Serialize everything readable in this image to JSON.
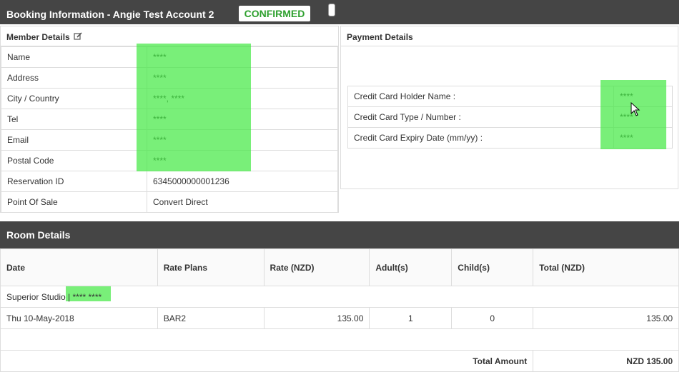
{
  "header": {
    "title": "Booking Information - Angie Test Account 2",
    "status": "CONFIRMED"
  },
  "member": {
    "heading": "Member Details",
    "rows": [
      {
        "label": "Name",
        "value": "****"
      },
      {
        "label": "Address",
        "value": "****"
      },
      {
        "label": "City / Country",
        "value": "****, ****"
      },
      {
        "label": "Tel",
        "value": "****"
      },
      {
        "label": "Email",
        "value": "****"
      },
      {
        "label": "Postal Code",
        "value": "****"
      },
      {
        "label": "Reservation ID",
        "value": "6345000000001236"
      },
      {
        "label": "Point Of Sale",
        "value": "Convert Direct"
      }
    ]
  },
  "payment": {
    "heading": "Payment Details",
    "rows": [
      {
        "label": "Credit Card Holder Name :",
        "value": "****"
      },
      {
        "label": "Credit Card Type / Number :",
        "value": "****"
      },
      {
        "label": "Credit Card Expiry Date (mm/yy) :",
        "value": "****"
      }
    ]
  },
  "room": {
    "heading": "Room Details",
    "columns": [
      "Date",
      "Rate Plans",
      "Rate (NZD)",
      "Adult(s)",
      "Child(s)",
      "Total (NZD)"
    ],
    "group": "Superior Studio | **** ****",
    "rows": [
      {
        "date": "Thu 10-May-2018",
        "plan": "BAR2",
        "rate": "135.00",
        "adults": "1",
        "children": "0",
        "total": "135.00"
      }
    ],
    "total_label": "Total Amount",
    "total_value": "NZD 135.00"
  },
  "colors": {
    "header_bg": "#454545",
    "confirmed": "#2ea02e",
    "redaction": "#40e840"
  }
}
